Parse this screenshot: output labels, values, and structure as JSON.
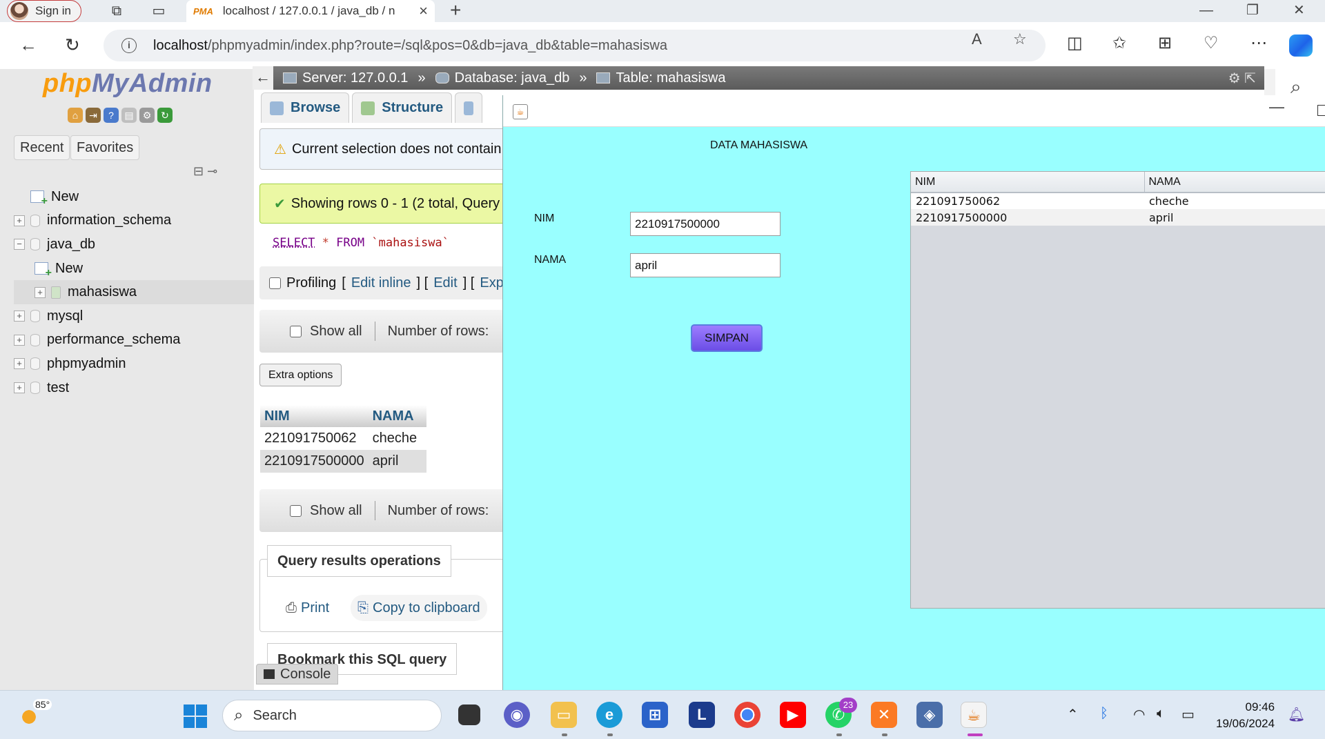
{
  "browser": {
    "signin_label": "Sign in",
    "tab_title": "localhost / 127.0.0.1 / java_db / n",
    "tab_icon_text": "PMA",
    "address_host": "localhost",
    "address_path": "/phpmyadmin/index.php?route=/sql&pos=0&db=java_db&table=mahasiswa"
  },
  "pma": {
    "logo_php": "php",
    "logo_myadmin": "MyAdmin",
    "nav_tabs": [
      "Recent",
      "Favorites"
    ],
    "tree": {
      "new": "New",
      "dbs": [
        "information_schema",
        "java_db",
        "mysql",
        "performance_schema",
        "phpmyadmin",
        "test"
      ],
      "java_db_new": "New",
      "java_db_table": "mahasiswa"
    },
    "breadcrumb": {
      "server": "Server: 127.0.0.1",
      "database": "Database: java_db",
      "table": "Table: mahasiswa",
      "sep": "»"
    },
    "tabs": [
      "Browse",
      "Structure"
    ],
    "warning_msg": "Current selection does not contain",
    "success_msg": "Showing rows 0 - 1 (2 total, Query",
    "sql": {
      "select": "SELECT",
      "star": "*",
      "from": "FROM",
      "table": "`mahasiswa`"
    },
    "profiling": {
      "label": "Profiling",
      "edit_inline": "Edit inline",
      "edit": "Edit",
      "explain": "Expla"
    },
    "show_all": "Show all",
    "number_of_rows": "Number of rows:",
    "extra_options": "Extra options",
    "result_table": {
      "headers": [
        "NIM",
        "NAMA"
      ],
      "rows": [
        [
          "221091750062",
          "cheche"
        ],
        [
          "2210917500000",
          "april"
        ]
      ]
    },
    "query_results_operations": "Query results operations",
    "print": "Print",
    "copy_to_clipboard": "Copy to clipboard",
    "bookmark": "Bookmark this SQL query",
    "console": "Console"
  },
  "java_app": {
    "heading": "DATA MAHASISWA",
    "nim_label": "NIM",
    "nama_label": "NAMA",
    "nim_value": "2210917500000",
    "nama_value": "april",
    "save_button": "SIMPAN",
    "table": {
      "headers": [
        "NIM",
        "NAMA"
      ],
      "rows": [
        [
          "221091750062",
          "cheche"
        ],
        [
          "2210917500000",
          "april"
        ]
      ]
    }
  },
  "taskbar": {
    "weather_temp": "85°",
    "search_placeholder": "Search",
    "whatsapp_badge": "23",
    "time": "09:46",
    "date": "19/06/2024"
  },
  "colors": {
    "java_bg": "#99ffff",
    "pma_link": "#235a81",
    "button_purple": "#6b4de6"
  }
}
